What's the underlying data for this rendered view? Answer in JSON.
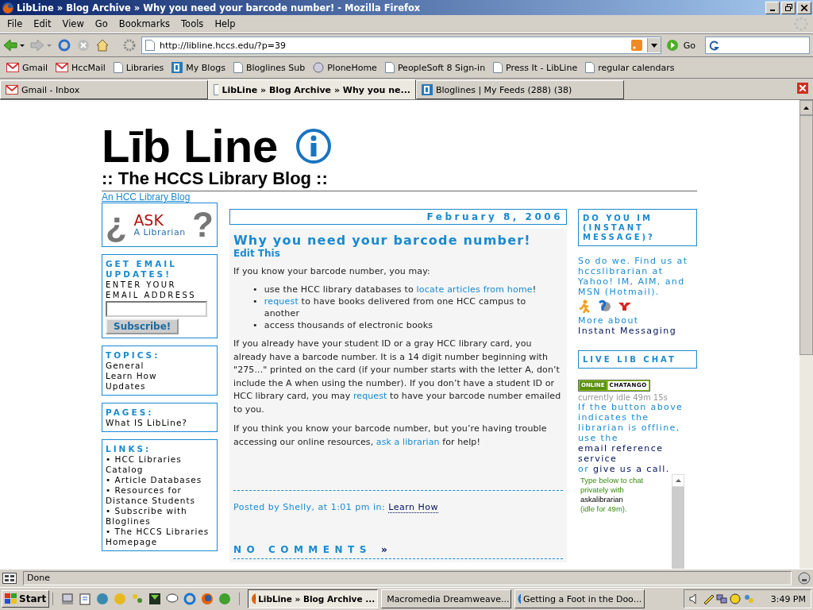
{
  "window": {
    "title": "LibLine » Blog Archive » Why you need your barcode number! - Mozilla Firefox"
  },
  "menu": [
    "File",
    "Edit",
    "View",
    "Go",
    "Bookmarks",
    "Tools",
    "Help"
  ],
  "toolbar": {
    "url": "http://libline.hccs.edu/?p=39",
    "go": "Go"
  },
  "bookmarks": [
    {
      "label": "Gmail",
      "kind": "mail"
    },
    {
      "label": "HccMail",
      "kind": "mail"
    },
    {
      "label": "Libraries",
      "kind": "page"
    },
    {
      "label": "My Blogs",
      "kind": "blog"
    },
    {
      "label": "Bloglines Sub",
      "kind": "page"
    },
    {
      "label": "PloneHome",
      "kind": "globe"
    },
    {
      "label": "PeopleSoft 8 Sign-in",
      "kind": "page"
    },
    {
      "label": "Press It - LibLine",
      "kind": "page"
    },
    {
      "label": "regular calendars",
      "kind": "page"
    }
  ],
  "tabs": [
    {
      "label": "Gmail - Inbox",
      "kind": "mail",
      "selected": false
    },
    {
      "label": "LibLine » Blog Archive » Why you ne...",
      "kind": "page",
      "selected": true
    },
    {
      "label": "Bloglines | My Feeds (288) (38)",
      "kind": "blog",
      "selected": false
    }
  ],
  "page": {
    "logo_title": "Līb Line",
    "subtitle": ":: The HCCS Library Blog ::",
    "tagline": "An HCC Library Blog",
    "ask_logo": {
      "open_mark": "¿",
      "top": "ASK",
      "bottom": "A Librarian",
      "close_mark": "?"
    },
    "email_box": {
      "heading": "GET EMAIL UPDATES!",
      "label": "ENTER YOUR EMAIL ADDRESS",
      "button": "Subscribe!"
    },
    "topics": {
      "heading": "TOPICS:",
      "items": [
        "General",
        "Learn How",
        "Updates"
      ]
    },
    "pages": {
      "heading": "PAGES:",
      "items": [
        "What IS LibLine?"
      ]
    },
    "links": {
      "heading": "LINKS:",
      "items": [
        "• HCC Libraries Catalog",
        "• Article Databases",
        "• Resources for Distance Students",
        "• Subscribe with Bloglines",
        "• The HCCS Libraries Homepage"
      ]
    },
    "post": {
      "date": "February 8, 2006",
      "title": "Why you need your barcode number!",
      "edit": "Edit This",
      "intro": "If you know your barcode number, you may:",
      "bullet": "•",
      "bullets": [
        [
          {
            "text": "use the HCC library databases to ",
            "kind": "text"
          },
          {
            "text": "locate articles from home",
            "kind": "link"
          },
          {
            "text": "!",
            "kind": "text"
          }
        ],
        [
          {
            "text": "request",
            "kind": "link"
          },
          {
            "text": " to have books delivered from one HCC campus to another",
            "kind": "text"
          }
        ],
        [
          {
            "text": "access thousands of electronic books",
            "kind": "text"
          }
        ]
      ],
      "paragraphs": [
        [
          {
            "text": "If you already have your student ID or a gray HCC library card, you already have a barcode number. It is a 14 digit number beginning with \"275...\" printed on the card (if your number starts with the letter A, don’t include the A when using the number). If you don’t have a student ID or HCC library card, you may ",
            "kind": "text"
          },
          {
            "text": "request",
            "kind": "link"
          },
          {
            "text": " to have your barcode number emailed to you.",
            "kind": "text"
          }
        ],
        [
          {
            "text": "If you think you know your barcode number, but you’re having trouble accessing our online resources, ",
            "kind": "text"
          },
          {
            "text": "ask a librarian",
            "kind": "link"
          },
          {
            "text": " for help!",
            "kind": "text"
          }
        ]
      ],
      "footer": "Posted by Shelly, at 1:01 pm in:",
      "category": "Learn How",
      "comments": "NO COMMENTS",
      "comments_arrow": "»"
    },
    "im": {
      "heading": "DO YOU IM (INSTANT MESSAGE)?",
      "text": [
        {
          "text": "So do we. Find us at hccslibrarian at Yahoo! IM, AIM, and MSN (Hotmail).",
          "kind": "text"
        }
      ],
      "more": [
        {
          "text": "More about ",
          "kind": "text"
        },
        {
          "text": "Instant Messaging",
          "kind": "link"
        }
      ]
    },
    "chat": {
      "heading": "LIVE LIB CHAT",
      "online": "ONLINE",
      "brand": "CHATANGO",
      "idle": "currently idle 49m 15s",
      "text": [
        {
          "text": "If the button above indicates the librarian is offline, use the ",
          "kind": "text"
        },
        {
          "text": "email reference service",
          "kind": "link"
        },
        {
          "text": " or ",
          "kind": "text"
        },
        {
          "text": "give us a call.",
          "kind": "link"
        }
      ],
      "box": {
        "prompt": "Type below to chat privately with",
        "user": "askalibrarian",
        "idle": "(idle for 49m)."
      }
    }
  },
  "status_bar": "Done",
  "taskbar": {
    "start": "Start",
    "tasks": [
      {
        "label": "LibLine » Blog Archive ...",
        "kind": "firefox",
        "selected": true
      },
      {
        "label": "Macromedia Dreamweave...",
        "kind": "dreamweaver",
        "selected": false
      },
      {
        "label": "Getting a Foot in the Doo...",
        "kind": "ie",
        "selected": false
      }
    ],
    "clock": "3:49 PM"
  }
}
